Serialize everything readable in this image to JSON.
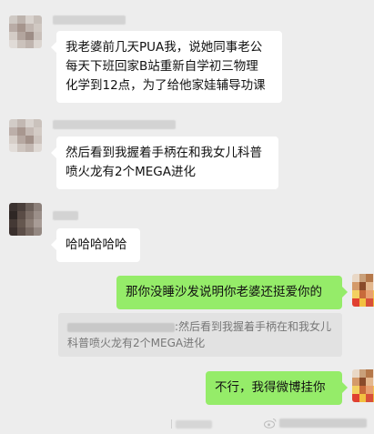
{
  "messages": [
    {
      "text": "我老婆前几天PUA我，说她同事老公\n每天下班回家B站重新自学初三物理\n化学到12点，为了给他家娃辅导功课"
    },
    {
      "text": "然后看到我握着手柄在和我女儿科普\n喷火龙有2个MEGA进化"
    },
    {
      "text": "哈哈哈哈哈"
    },
    {
      "text": "那你没睡沙发说明你老婆还挺爱你的"
    },
    {
      "text": "不行，我得微博挂你"
    }
  ],
  "quote": {
    "separator": ":",
    "text": "然后看到我握着手柄在和我女儿\n科普喷火龙有2个MEGA进化"
  },
  "icons": {
    "watermark": "weibo-icon"
  },
  "colors": {
    "background": "#ededed",
    "bubble_in": "#ffffff",
    "bubble_out": "#95ec69"
  }
}
